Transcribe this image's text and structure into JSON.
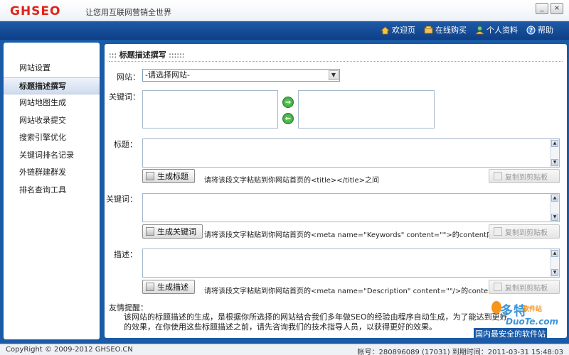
{
  "app": {
    "logo": "GHSEO",
    "slogan": "让您用互联网营销全世界",
    "window_buttons": [
      "_",
      "×"
    ]
  },
  "topnav": [
    {
      "label": "欢迎页",
      "icon": "home-icon"
    },
    {
      "label": "在线购买",
      "icon": "cart-icon"
    },
    {
      "label": "个人资料",
      "icon": "user-icon"
    },
    {
      "label": "帮助",
      "icon": "help-icon"
    }
  ],
  "sidebar": {
    "items": [
      {
        "label": "网站设置",
        "active": false
      },
      {
        "label": "标题描述撰写",
        "active": true
      },
      {
        "label": "网站地图生成",
        "active": false
      },
      {
        "label": "网站收录提交",
        "active": false
      },
      {
        "label": "搜索引擎优化",
        "active": false
      },
      {
        "label": "关键词排名记录",
        "active": false
      },
      {
        "label": "外链群建群发",
        "active": false
      },
      {
        "label": "排名查询工具",
        "active": false
      }
    ]
  },
  "main": {
    "title_prefix": ":::",
    "title": "标题描述撰写",
    "title_suffix": "::::::",
    "website_label": "网站：",
    "website_value": "-请选择网站-",
    "keyword_label": "关键词：",
    "title_label": "标题：",
    "title_button": "生成标题",
    "title_hint": "请将该段文字粘贴到你网站首页的<title></title>之间",
    "keywords_label": "关键词：",
    "keywords_button": "生成关键词",
    "keywords_hint": "请将该段文字粘贴到你网站首页的<meta name=\"Keywords\" content=\"\">的content内",
    "desc_label": "描述：",
    "desc_button": "生成描述",
    "desc_hint": "请将该段文字粘贴到你网站首页的<meta name=\"Description\" content=\"\"/>的content内",
    "copy_button": "复制到剪贴板",
    "tip_title": "友情提醒：",
    "tip_text": "该网站的标题描述的生成，是根据你所选择的网站结合我们多年做SEO的经验由程序自动生成，为了能达到更好的效果，在你使用这些标题描述之前，请先咨询我们的技术指导人员，以获得更好的效果。"
  },
  "watermark": {
    "brand": "多特",
    "tag": "软件站",
    "domain": "DuoTe.com",
    "slogan": "国内最安全的软件站"
  },
  "status": {
    "copyright": "CopyRight © 2009-2012 GHSEO.CN",
    "account": "帐号：280896089 (17031)  到期时间：2011-03-31 15:48:03"
  }
}
